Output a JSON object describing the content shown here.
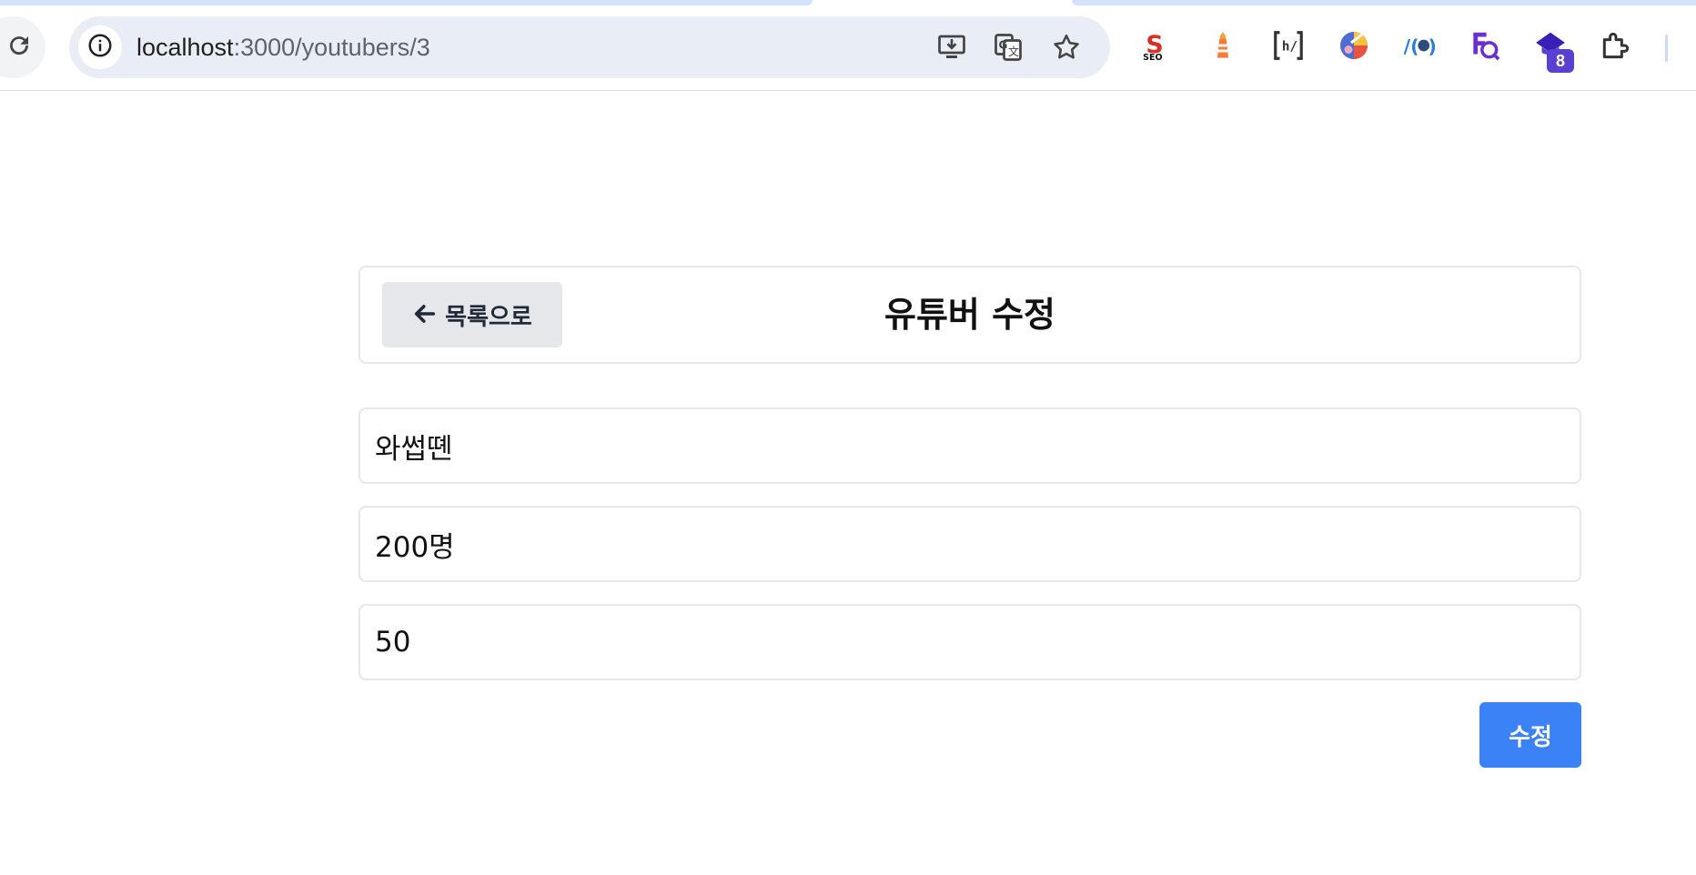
{
  "browser": {
    "url_host": "localhost",
    "url_path": ":3000/youtubers/3",
    "toolbar_icons": [
      "install-app-icon",
      "translate-icon",
      "bookmark-star-icon"
    ],
    "extensions": [
      "seo-extension-icon",
      "lighthouse-extension-icon",
      "html-validator-extension-icon",
      "colorful-extension-icon",
      "github-extension-icon",
      "search-extension-icon",
      "badge-extension-icon",
      "puzzle-extensions-icon"
    ],
    "extension_badge": "8",
    "accent_color": "#d3e3fd"
  },
  "page": {
    "back_label": "목록으로",
    "title": "유튜버 수정",
    "fields": {
      "name": "와썹뗸",
      "subscribers": "200명",
      "views": "50"
    },
    "submit_label": "수정",
    "primary_color": "#3b82f6",
    "secondary_button_color": "#e5e7eb"
  }
}
